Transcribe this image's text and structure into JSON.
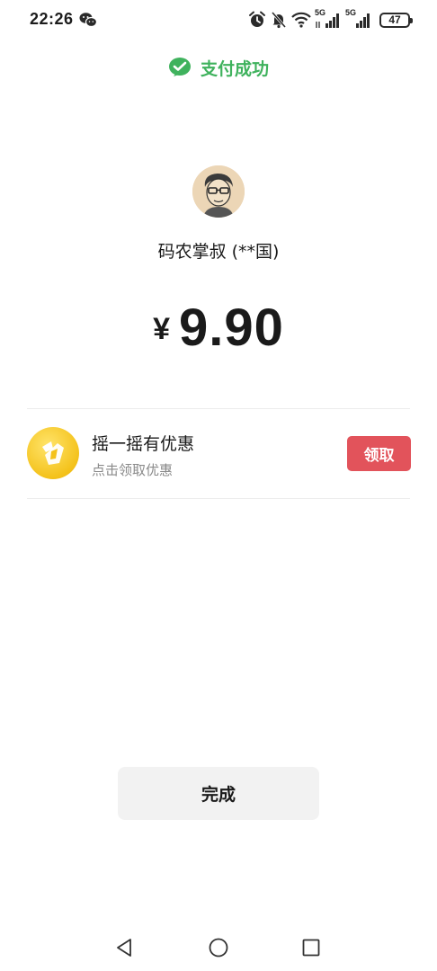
{
  "status_bar": {
    "time": "22:26",
    "battery": "47",
    "signal_1_label": "5G",
    "signal_2_label": "5G",
    "icons": [
      "wechat-icon",
      "alarm-icon",
      "mute-bell-icon",
      "wifi-icon",
      "signal-icon",
      "signal-icon",
      "battery-icon"
    ]
  },
  "header": {
    "success_text": "支付成功",
    "success_color": "#3fb25d"
  },
  "merchant": {
    "name": "码农掌叔 (**国)"
  },
  "payment": {
    "currency_symbol": "¥",
    "amount": "9.90"
  },
  "promo": {
    "title": "摇一摇有优惠",
    "subtitle": "点击领取优惠",
    "claim_label": "领取",
    "claim_color": "#e2535b"
  },
  "footer": {
    "done_label": "完成"
  },
  "nav": {
    "icons": [
      "back-icon",
      "home-icon",
      "recent-apps-icon"
    ]
  }
}
